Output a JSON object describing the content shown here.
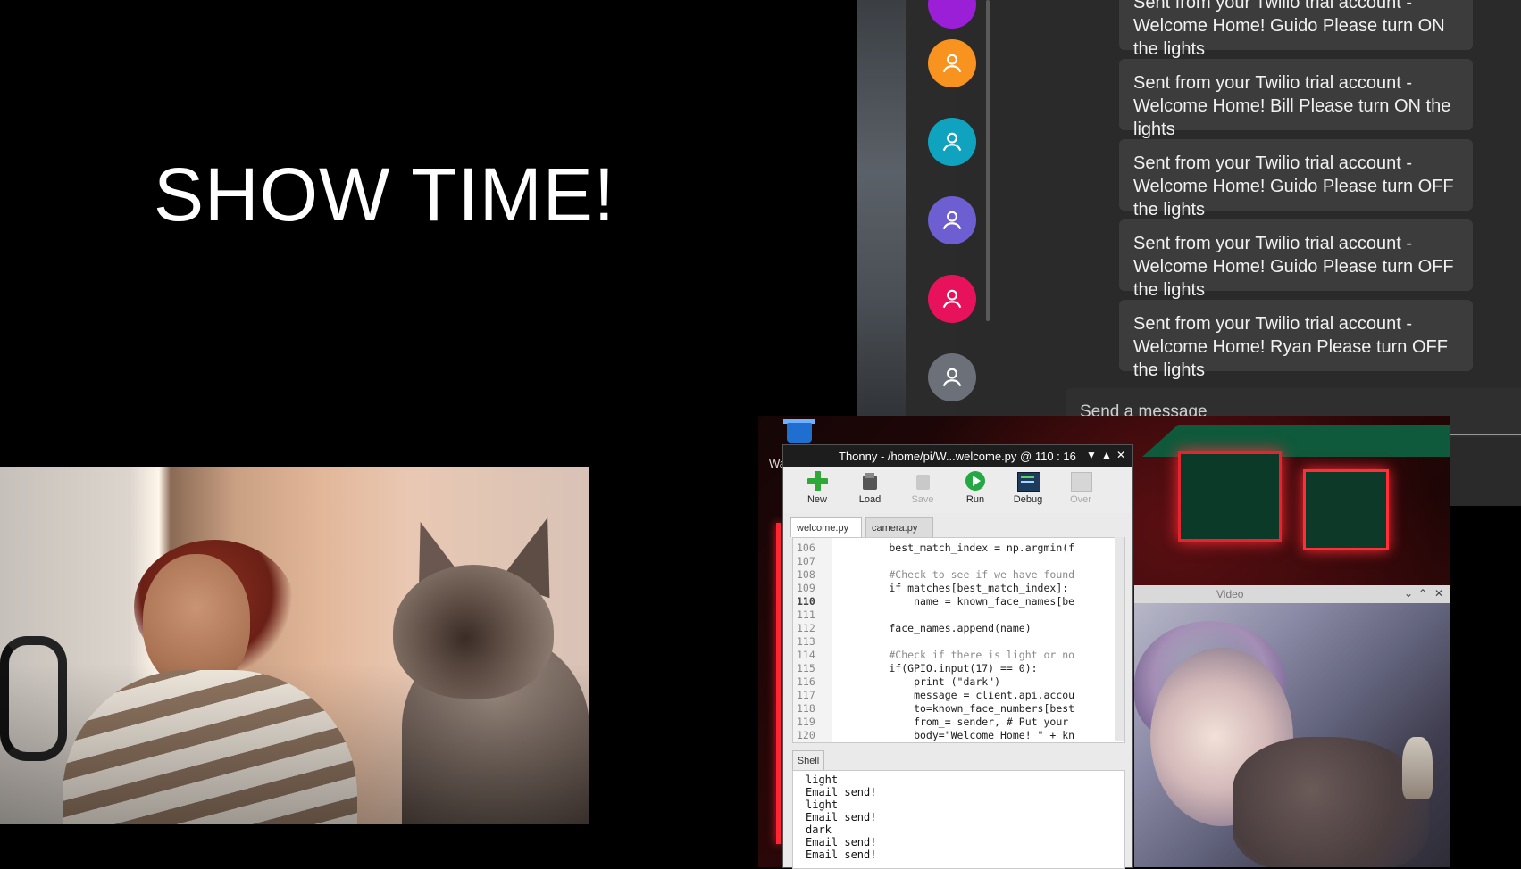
{
  "slide": {
    "title": "SHOW TIME!"
  },
  "messaging": {
    "avatar_colors": [
      "#f7931e",
      "#0fa3bf",
      "#6d5fd1",
      "#e8125c",
      "#6b7079"
    ],
    "messages": [
      "Sent from your Twilio trial account - Welcome Home! Guido Please turn ON the lights",
      "Sent from your Twilio trial account - Welcome Home! Bill Please turn ON the lights",
      "Sent from your Twilio trial account - Welcome Home! Guido Please turn OFF the lights",
      "Sent from your Twilio trial account - Welcome Home! Guido Please turn OFF the lights",
      "Sent from your Twilio trial account - Welcome Home! Ryan Please turn OFF the lights"
    ],
    "compose_placeholder": "Send a message"
  },
  "desktop": {
    "label_fragment": "Wa"
  },
  "thonny": {
    "title": "Thonny  -  /home/pi/W...welcome.py  @  110 : 16",
    "toolbar": {
      "new": "New",
      "load": "Load",
      "save": "Save",
      "run": "Run",
      "debug": "Debug",
      "over": "Over"
    },
    "tabs": [
      "welcome.py",
      "camera.py"
    ],
    "line_numbers": [
      "106",
      "107",
      "108",
      "109",
      "110",
      "111",
      "112",
      "113",
      "114",
      "115",
      "116",
      "117",
      "118",
      "119",
      "120"
    ],
    "code_lines": [
      "        best_match_index = np.argmin(f",
      "",
      "        #Check to see if we have found",
      "        if matches[best_match_index]:",
      "            name = known_face_names[be",
      "",
      "        face_names.append(name)",
      "",
      "        #Check if there is light or no",
      "        if(GPIO.input(17) == 0):",
      "            print (\"dark\")",
      "            message = client.api.accou",
      "            to=known_face_numbers[best",
      "            from_= sender, # Put your",
      "            body=\"Welcome Home! \" + kn"
    ],
    "shell_tab": "Shell",
    "shell_lines": [
      "light",
      "Email send!",
      "light",
      "Email send!",
      "dark",
      "Email send!",
      "Email send!"
    ]
  },
  "video": {
    "title": "Video"
  }
}
